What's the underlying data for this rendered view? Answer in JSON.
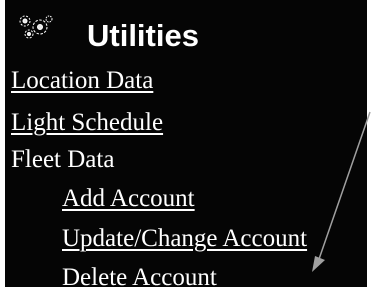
{
  "header": {
    "title": "Utilities",
    "icon": "gears-icon"
  },
  "menu": {
    "location_data": "Location Data",
    "light_schedule": "Light Schedule",
    "fleet_data": "Fleet Data",
    "add_account": "Add Account",
    "update_change_account": "Update/Change Account",
    "delete_account": "Delete Account"
  },
  "colors": {
    "background": "#050505",
    "text": "#ffffff",
    "arrow": "#a0a0a0"
  }
}
